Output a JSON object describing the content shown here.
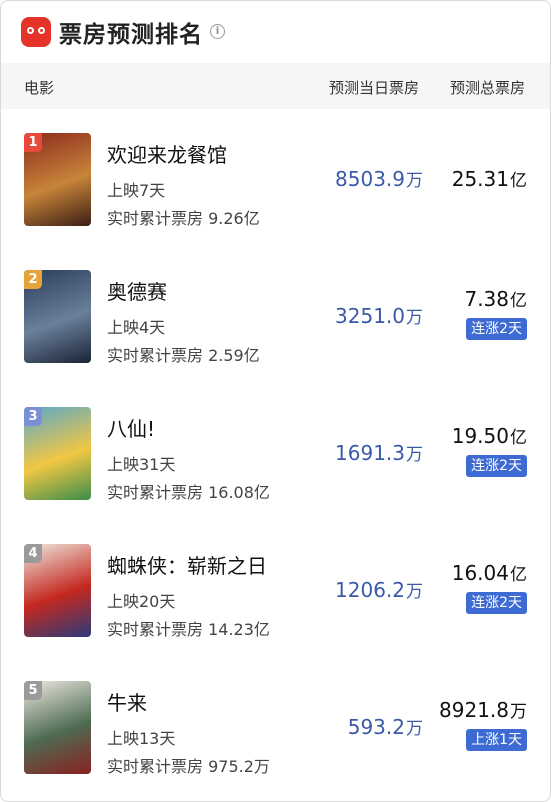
{
  "header": {
    "title": "票房预测排名",
    "info_icon": "i"
  },
  "columns": {
    "movie": "电影",
    "day_forecast": "预测当日票房",
    "total_forecast": "预测总票房"
  },
  "colors": {
    "accent_blue": "#3a5aa8",
    "badge_blue": "#3e6bd3",
    "brand_red": "#e5332a"
  },
  "movies": [
    {
      "rank": "1",
      "rank_color": "#e64a3a",
      "name": "欢迎来龙餐馆",
      "days_showing": "上映7天",
      "cumulative": "实时累计票房 9.26亿",
      "day_value": "8503.9",
      "day_unit": "万",
      "total_value": "25.31",
      "total_unit": "亿",
      "badge": "",
      "poster_colors": [
        "#8a2a1c",
        "#c8843a",
        "#3a1e14"
      ]
    },
    {
      "rank": "2",
      "rank_color": "#e5a33a",
      "name": "奥德赛",
      "days_showing": "上映4天",
      "cumulative": "实时累计票房 2.59亿",
      "day_value": "3251.0",
      "day_unit": "万",
      "total_value": "7.38",
      "total_unit": "亿",
      "badge": "连涨2天",
      "poster_colors": [
        "#2a3e5c",
        "#6a7f9a",
        "#1a2336"
      ]
    },
    {
      "rank": "3",
      "rank_color": "#7a8fd6",
      "name": "八仙!",
      "days_showing": "上映31天",
      "cumulative": "实时累计票房 16.08亿",
      "day_value": "1691.3",
      "day_unit": "万",
      "total_value": "19.50",
      "total_unit": "亿",
      "badge": "连涨2天",
      "poster_colors": [
        "#5aa9c9",
        "#f2c744",
        "#3b8d4a"
      ]
    },
    {
      "rank": "4",
      "rank_color": "#9a9a9a",
      "name": "蜘蛛侠：崭新之日",
      "days_showing": "上映20天",
      "cumulative": "实时累计票房 14.23亿",
      "day_value": "1206.2",
      "day_unit": "万",
      "total_value": "16.04",
      "total_unit": "亿",
      "badge": "连涨2天",
      "poster_colors": [
        "#efe9e0",
        "#c4281f",
        "#2b3b7a"
      ]
    },
    {
      "rank": "5",
      "rank_color": "#9a9a9a",
      "name": "牛来",
      "days_showing": "上映13天",
      "cumulative": "实时累计票房 975.2万",
      "day_value": "593.2",
      "day_unit": "万",
      "total_value": "8921.8",
      "total_unit": "万",
      "badge": "上涨1天",
      "poster_colors": [
        "#eeeae2",
        "#4e6b52",
        "#8a2020"
      ]
    }
  ]
}
